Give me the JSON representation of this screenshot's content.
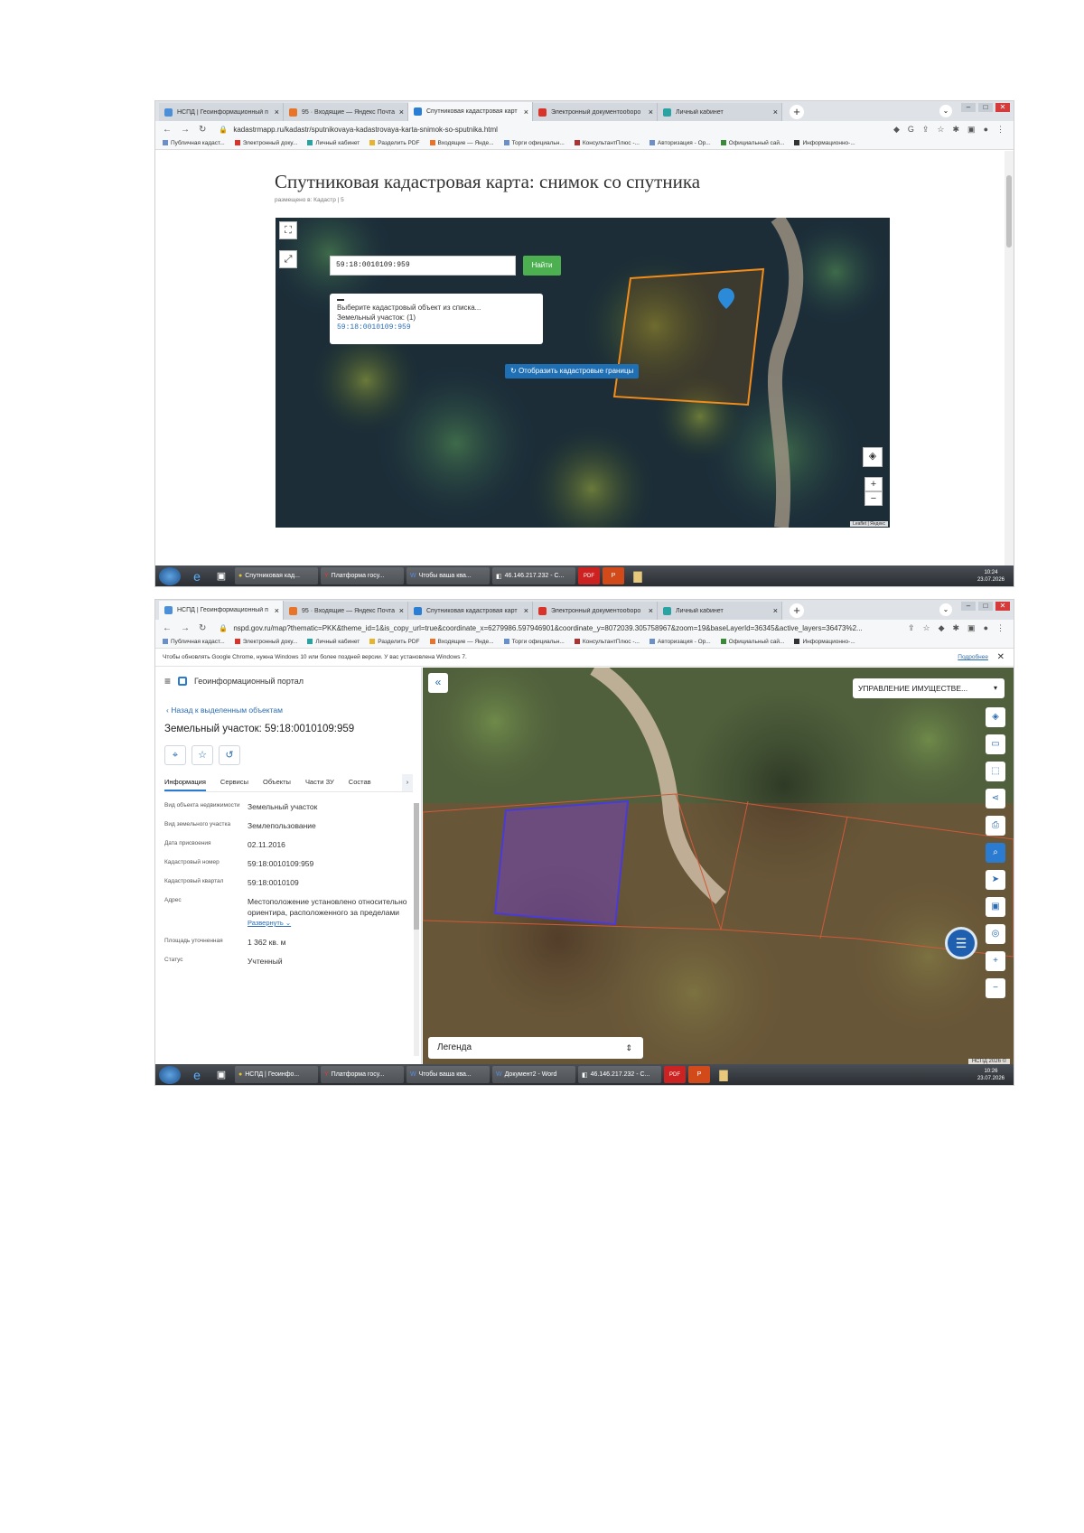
{
  "browser": {
    "tabs": [
      {
        "label": "НСПД | Геоинформационный п",
        "color": "#4a8fd8"
      },
      {
        "label": "95 · Входящие — Яндекс Почта",
        "color": "#e8742a"
      },
      {
        "label": "Спутниковая кадастровая карт",
        "color": "#2a7fd4"
      },
      {
        "label": "Электронный документооборо",
        "color": "#d8342a"
      },
      {
        "label": "Личный кабинет",
        "color": "#2aa3a3"
      }
    ],
    "bookmarks": [
      "Публичная кадаст...",
      "Электронный доку...",
      "Личный кабинет",
      "Разделить PDF",
      "Входящие — Янде...",
      "Торги официальн...",
      "КонсультантПлюс -...",
      "Авторизация - Ор...",
      "Официальный сай...",
      "Информационно-..."
    ]
  },
  "shot1": {
    "url": "kadastrmapp.ru/kadastr/sputnikovaya-kadastrovaya-karta-snimok-so-sputnika.html",
    "title": "Спутниковая кадастровая карта: снимок со спутника",
    "meta": "размещено в: Кадастр  |  5",
    "search_value": "59:18:0010109:959",
    "find_label": "Найти",
    "popup_title": "Выберите кадастровый объект из списка...",
    "popup_sub": "Земельный участок: (1)",
    "popup_link": "59:18:0010109:959",
    "boundary_btn": "Отобразить кадастровые границы",
    "attribution": "Leaflet | Яндекс",
    "taskbar": [
      "Спутниковая кад...",
      "Платформа госу...",
      "Чтобы ваша ква...",
      "46.146.217.232 - С..."
    ],
    "time": "10:24",
    "date": "23.07.2026"
  },
  "shot2": {
    "url": "nspd.gov.ru/map?thematic=PKK&theme_id=1&is_copy_url=true&coordinate_x=6279986.597946901&coordinate_y=8072039.305758967&zoom=19&baseLayerId=36345&active_layers=36473%2...",
    "notice": "Чтобы обновлять Google Chrome, нужна Windows 10 или более поздней версии. У вас установлена Windows 7.",
    "notice_link": "Подробнее",
    "portal": "Геоинформационный портал",
    "back": "Назад к выделенным объектам",
    "object_title": "Земельный участок: 59:18:0010109:959",
    "tabs": [
      "Информация",
      "Сервисы",
      "Объекты",
      "Части ЗУ",
      "Состав"
    ],
    "props": [
      {
        "k": "Вид объекта недвижимости",
        "v": "Земельный участок"
      },
      {
        "k": "Вид земельного участка",
        "v": "Землепользование"
      },
      {
        "k": "Дата присвоения",
        "v": "02.11.2016"
      },
      {
        "k": "Кадастровый номер",
        "v": "59:18:0010109:959"
      },
      {
        "k": "Кадастровый квартал",
        "v": "59:18:0010109"
      },
      {
        "k": "Адрес",
        "v": "Местоположение установлено относительно ориентира, расположенного за пределами"
      },
      {
        "k": "Площадь уточненная",
        "v": "1 362 кв. м"
      },
      {
        "k": "Статус",
        "v": "Учтенный"
      }
    ],
    "expand": "Развернуть",
    "mgmt": "УПРАВЛЕНИЕ ИМУЩЕСТВЕ...",
    "legend": "Легенда",
    "attribution": "НСПД 2026 ©",
    "taskbar": [
      "НСПД | Геоинфо...",
      "Платформа госу...",
      "Чтобы ваша ква...",
      "Документ2 - Word",
      "46.146.217.232 - С..."
    ],
    "time": "10:26",
    "date": "23.07.2026"
  }
}
